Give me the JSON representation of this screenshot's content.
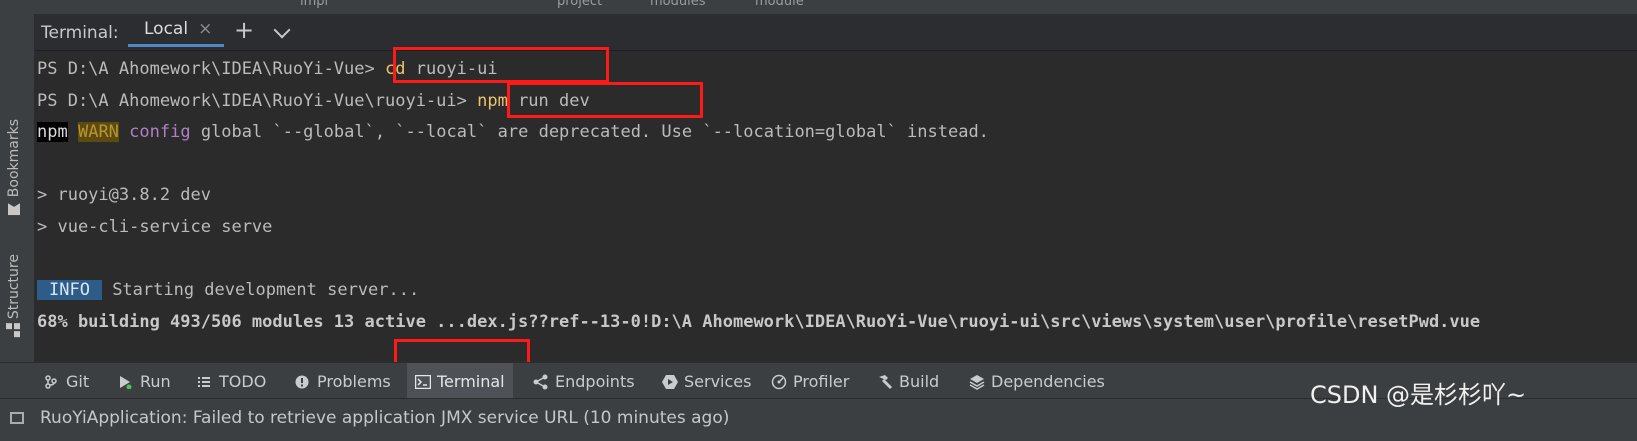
{
  "top_strip": {
    "crumbs": [
      "impl",
      "project",
      "modules",
      "module"
    ]
  },
  "left_sidebar": {
    "bookmarks_label": "Bookmarks",
    "structure_label": "Structure"
  },
  "terminal_header": {
    "title": "Terminal:",
    "tab_label": "Local",
    "close_glyph": "×",
    "new_tab_glyph": "+"
  },
  "terminal": {
    "line1_prompt": "PS D:\\A Ahomework\\IDEA\\RuoYi-Vue> ",
    "line1_cmd": "cd",
    "line1_arg": " ruoyi-ui",
    "line2_prompt": "PS D:\\A Ahomework\\IDEA\\RuoYi-Vue\\ruoyi-ui> ",
    "line2_cmd": "npm",
    "line2_arg": " run dev",
    "line3_npm": "npm",
    "line3_warn": "WARN",
    "line3_config": "config",
    "line3_rest": " global `--global`, `--local` are deprecated. Use `--location=global` instead.",
    "line4": "> ruoyi@3.8.2 dev",
    "line5": "> vue-cli-service serve",
    "line6_badge": "INFO",
    "line6_text": " Starting development server...",
    "line7": "68% building 493/506 modules 13 active ...dex.js??ref--13-0!D:\\A Ahomework\\IDEA\\RuoYi-Vue\\ruoyi-ui\\src\\views\\system\\user\\profile\\resetPwd.vue"
  },
  "tool_windows": [
    {
      "label": "Git",
      "icon": "git-branch-icon"
    },
    {
      "label": "Run",
      "icon": "run-icon"
    },
    {
      "label": "TODO",
      "icon": "todo-list-icon"
    },
    {
      "label": "Problems",
      "icon": "problems-icon"
    },
    {
      "label": "Terminal",
      "icon": "terminal-icon",
      "active": true
    },
    {
      "label": "Endpoints",
      "icon": "endpoints-icon"
    },
    {
      "label": "Services",
      "icon": "services-icon"
    },
    {
      "label": "Profiler",
      "icon": "profiler-icon"
    },
    {
      "label": "Build",
      "icon": "build-hammer-icon"
    },
    {
      "label": "Dependencies",
      "icon": "dependencies-icon"
    }
  ],
  "status_bar": {
    "message": "RuoYiApplication: Failed to retrieve application JMX service URL (10 minutes ago)"
  },
  "watermark": "CSDN @是杉杉吖~",
  "colors": {
    "highlight_box": "#ff1a1a",
    "active_tab_underline": "#4a88c7",
    "command_yellow": "#e8c46a",
    "info_badge": "#2d5c88"
  }
}
